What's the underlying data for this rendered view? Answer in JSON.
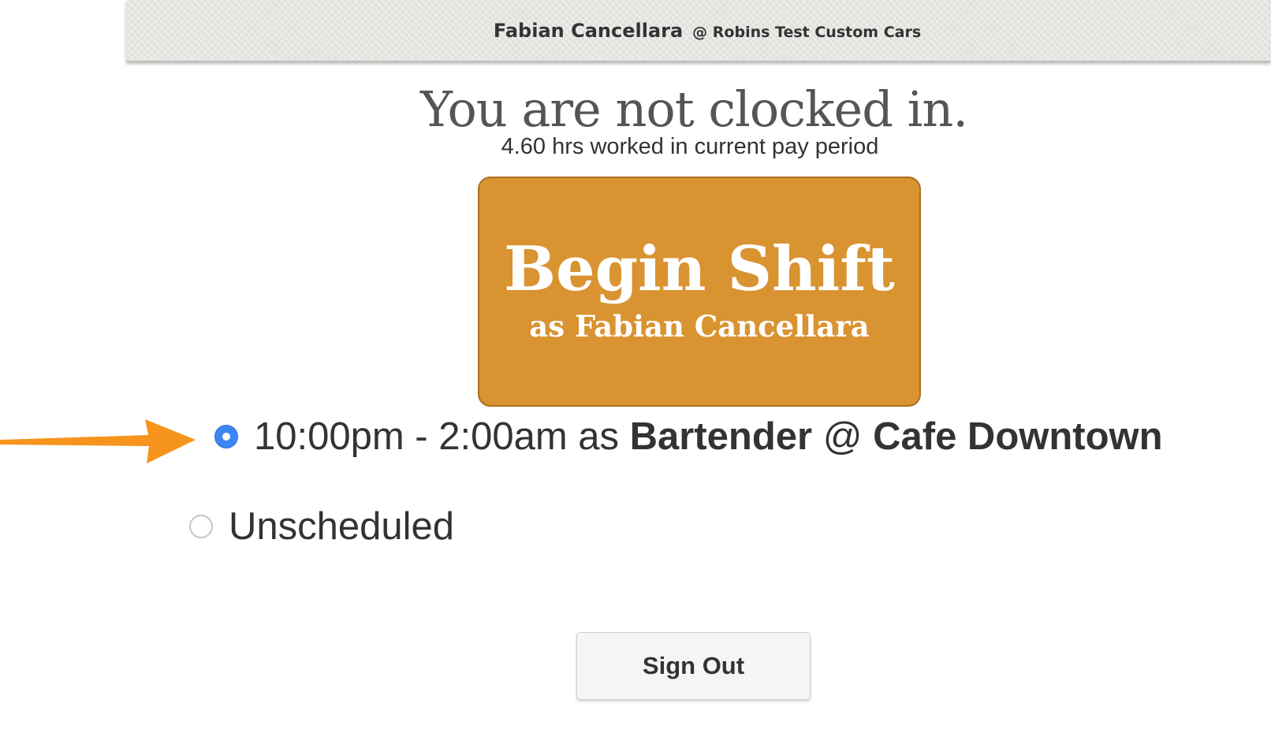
{
  "header": {
    "user_name": "Fabian Cancellara",
    "company": "@ Robins Test Custom Cars"
  },
  "status": {
    "title": "You are not clocked in.",
    "hours_worked": "4.60 hrs worked in current pay period"
  },
  "begin_shift": {
    "label": "Begin Shift",
    "sublabel": "as Fabian Cancellara",
    "color": "#d99331"
  },
  "shift_options": [
    {
      "time": "10:00pm - 2:00am as ",
      "role": "Bartender",
      "separator": " @ ",
      "location": "Cafe Downtown",
      "selected": true
    },
    {
      "label": "Unscheduled",
      "selected": false
    }
  ],
  "annotation": {
    "arrow_color": "#f7941d",
    "arrow_icon": "arrow-right-icon"
  },
  "sign_out": {
    "label": "Sign Out"
  },
  "colors": {
    "radio_selected": "#3d86f5",
    "header_bg": "#e3e6e1"
  }
}
